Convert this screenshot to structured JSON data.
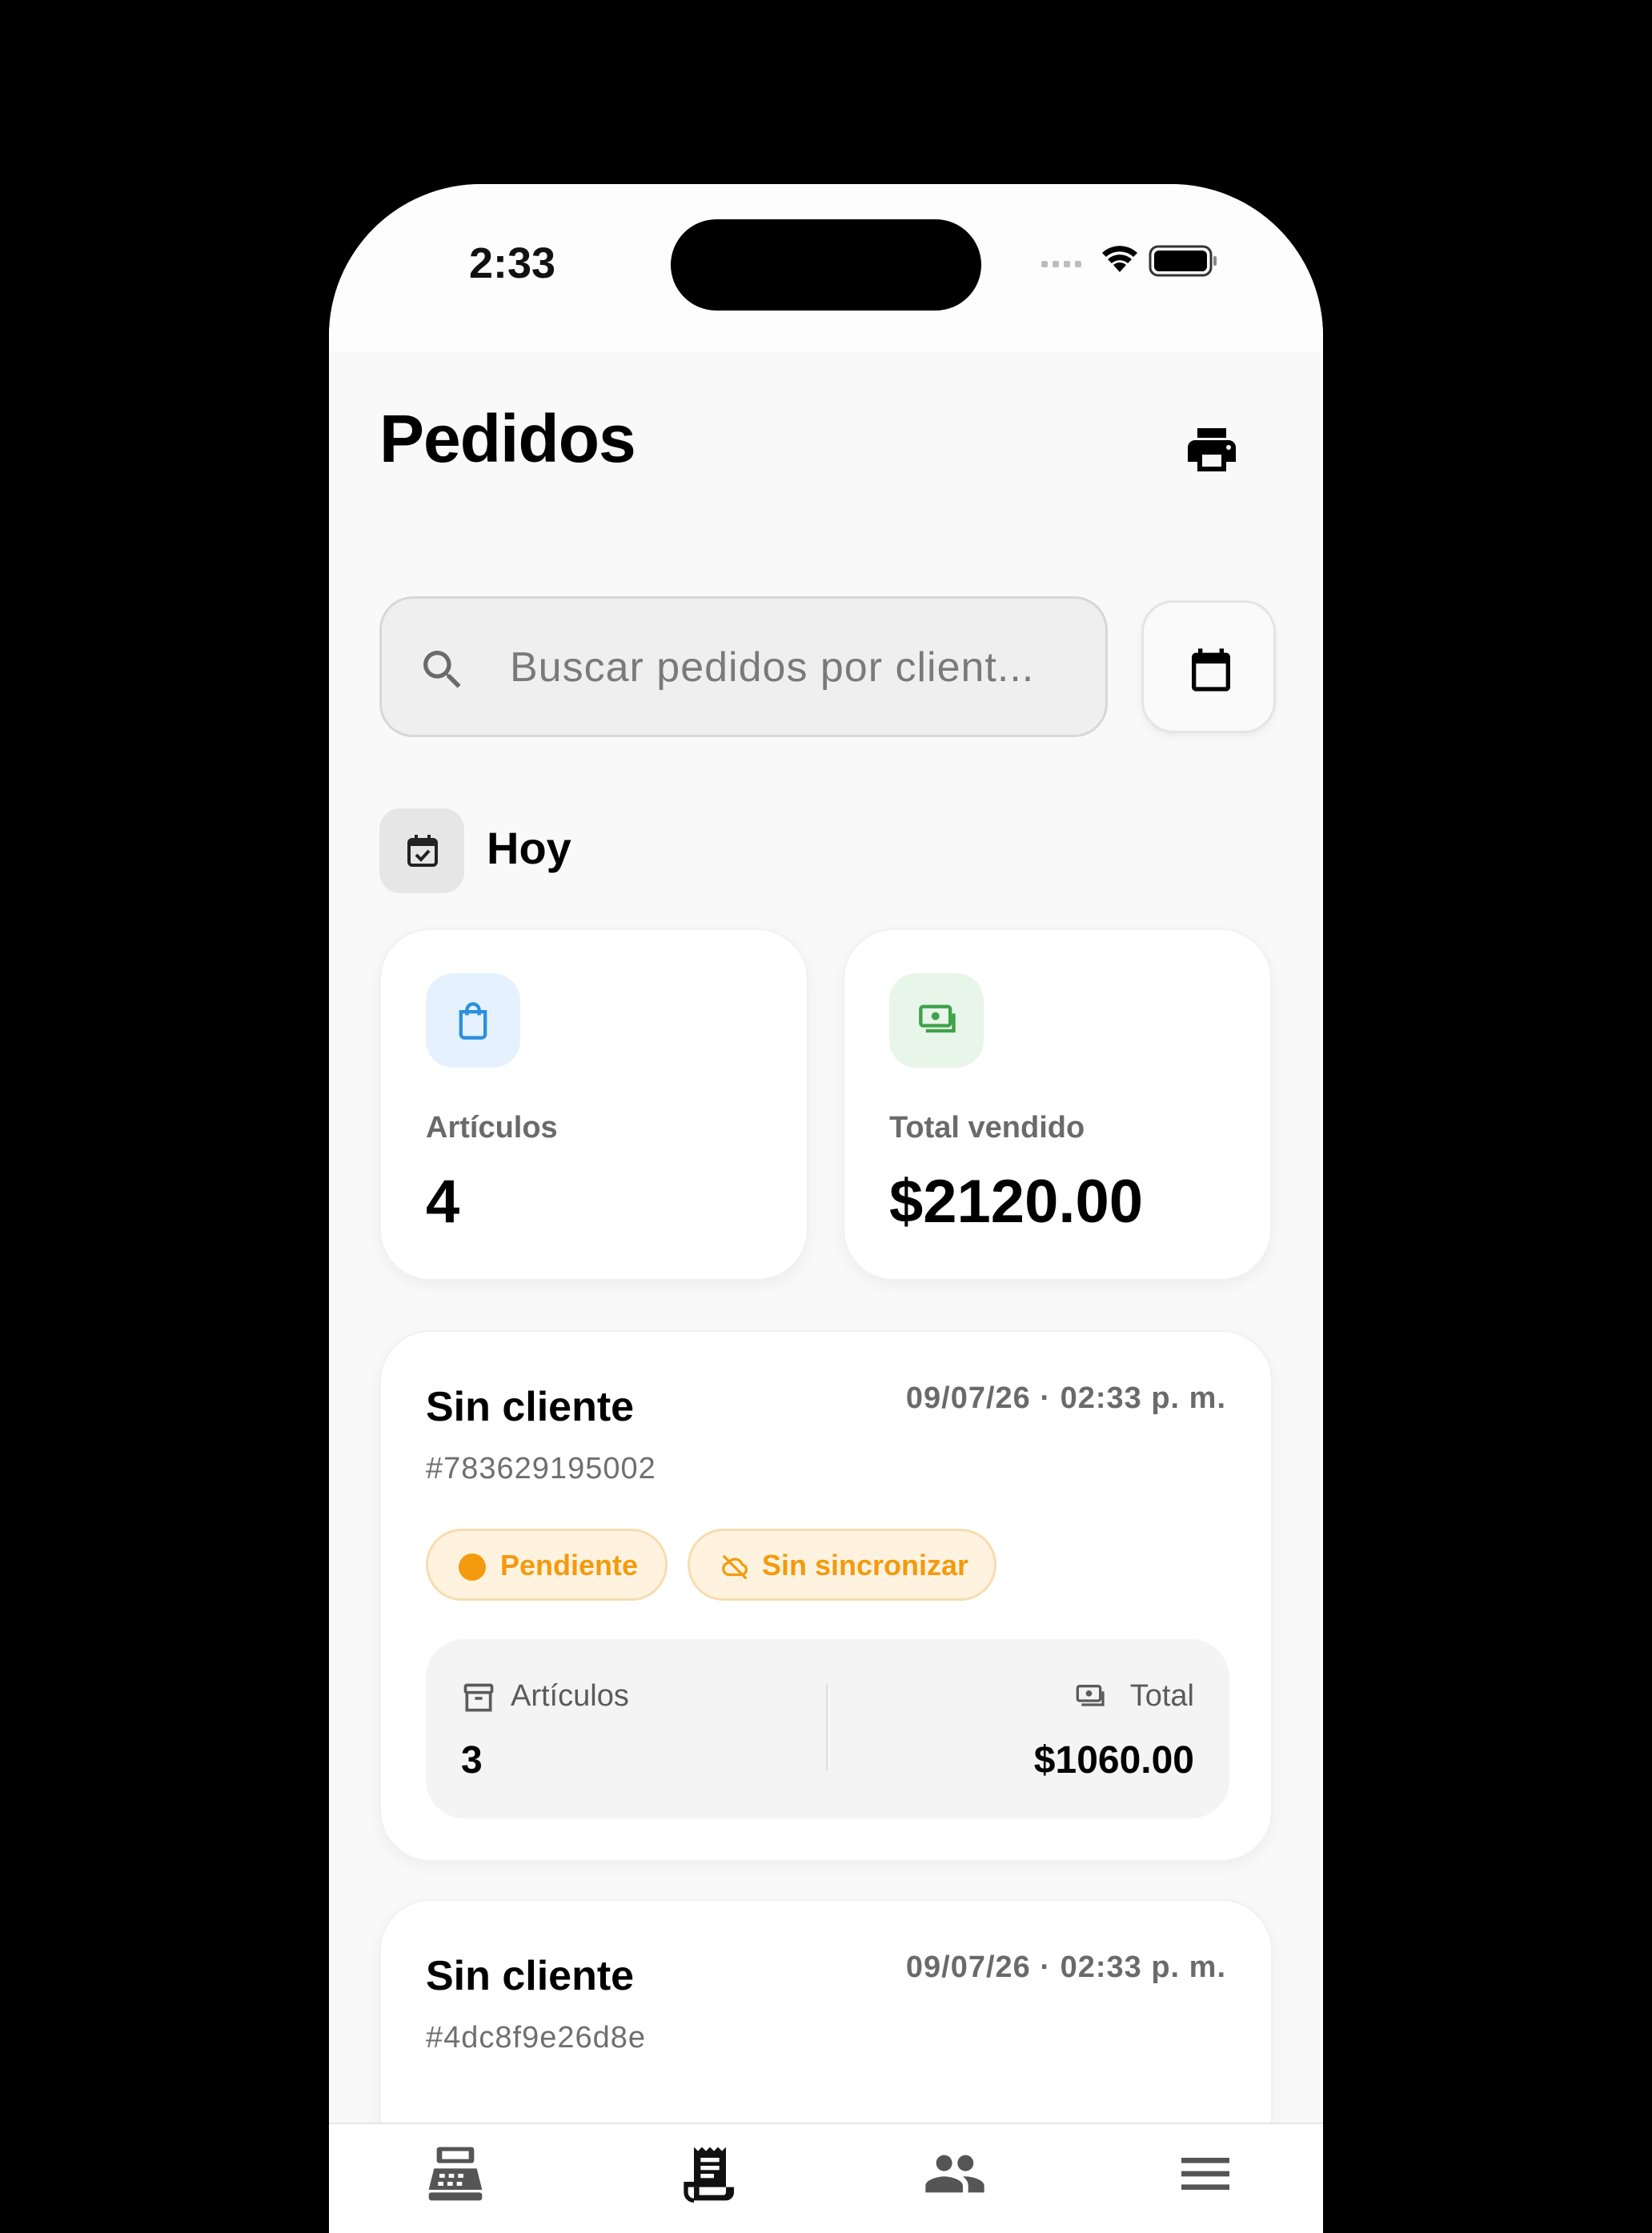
{
  "status_bar": {
    "time": "2:33"
  },
  "header": {
    "title": "Pedidos"
  },
  "search": {
    "placeholder": "Buscar pedidos por client..."
  },
  "filter": {
    "label": "Hoy"
  },
  "stats": [
    {
      "label": "Artículos",
      "value": "4",
      "icon": "shopping-bag-icon",
      "icon_color": "#2a8fe0",
      "bg": "#e5f2fd"
    },
    {
      "label": "Total vendido",
      "value": "$2120.00",
      "icon": "money-icon",
      "icon_color": "#3ea24a",
      "bg": "#e8f5e9"
    }
  ],
  "orders": [
    {
      "client": "Sin cliente",
      "date": "09/07/26 · 02:33 p. m.",
      "id": "#783629195002",
      "status": "Pendiente",
      "sync": "Sin sincronizar",
      "items_label": "Artículos",
      "items_value": "3",
      "total_label": "Total",
      "total_value": "$1060.00"
    },
    {
      "client": "Sin cliente",
      "date": "09/07/26 · 02:33 p. m.",
      "id": "#4dc8f9e26d8e"
    }
  ],
  "tabbar": [
    {
      "icon": "cash-register-icon"
    },
    {
      "icon": "receipt-icon",
      "active": true
    },
    {
      "icon": "people-icon"
    },
    {
      "icon": "menu-icon"
    }
  ]
}
